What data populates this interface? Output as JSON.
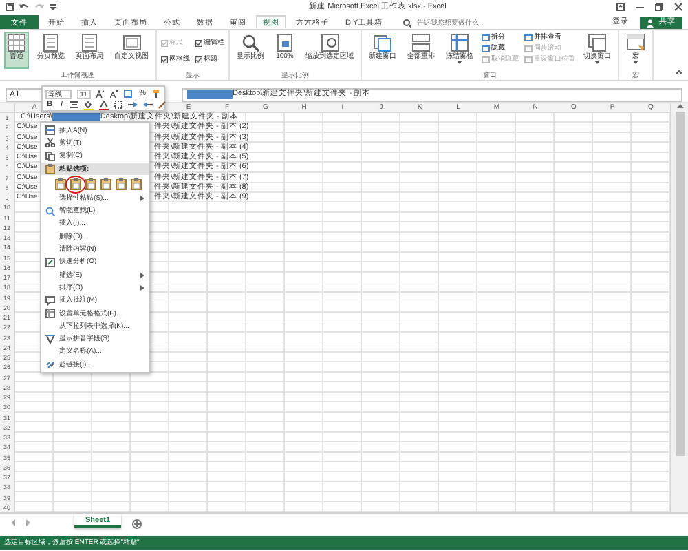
{
  "title_bar": {
    "title": "新建 Microsoft Excel 工作表.xlsx - Excel"
  },
  "tabs": [
    {
      "label": "文件",
      "kind": "file",
      "selected": false
    },
    {
      "label": "开始",
      "kind": "tab",
      "selected": false
    },
    {
      "label": "插入",
      "kind": "tab",
      "selected": false
    },
    {
      "label": "页面布局",
      "kind": "tab",
      "selected": false
    },
    {
      "label": "公式",
      "kind": "tab",
      "selected": false
    },
    {
      "label": "数据",
      "kind": "tab",
      "selected": false
    },
    {
      "label": "审阅",
      "kind": "tab",
      "selected": false
    },
    {
      "label": "视图",
      "kind": "tab",
      "selected": true
    },
    {
      "label": "方方格子",
      "kind": "tab",
      "selected": false
    },
    {
      "label": "DIY工具箱",
      "kind": "tab",
      "selected": false
    }
  ],
  "tell_me": {
    "placeholder": "告诉我您想要做什么..."
  },
  "account": {
    "sign_in": "登录",
    "share": "共享"
  },
  "ribbon": [
    {
      "title": "工作簿视图",
      "columns": [
        [
          {
            "kind": "large",
            "label": "普通",
            "selected": true
          }
        ],
        [
          {
            "kind": "large",
            "label": "分页预览",
            "selected": false
          }
        ],
        [
          {
            "kind": "large",
            "label": "页面布局",
            "selected": false
          }
        ],
        [
          {
            "kind": "large",
            "label": "自定义视图",
            "selected": false
          }
        ]
      ]
    },
    {
      "title": "显示",
      "columns": [
        [
          {
            "kind": "check",
            "label": "标尺",
            "checked": true,
            "disabled": true
          },
          {
            "kind": "check",
            "label": "网格线",
            "checked": true,
            "disabled": false
          }
        ],
        [
          {
            "kind": "check",
            "label": "编辑栏",
            "checked": true,
            "disabled": false
          },
          {
            "kind": "check",
            "label": "标题",
            "checked": true,
            "disabled": false
          }
        ]
      ]
    },
    {
      "title": "显示比例",
      "columns": [
        [
          {
            "kind": "large",
            "label": "显示比例"
          }
        ],
        [
          {
            "kind": "large",
            "label": "100%"
          }
        ],
        [
          {
            "kind": "large",
            "label": "缩放到选定区域"
          }
        ]
      ]
    },
    {
      "title": "窗口",
      "columns": [
        [
          {
            "kind": "large",
            "label": "新建窗口"
          }
        ],
        [
          {
            "kind": "large",
            "label": "全部重排"
          }
        ],
        [
          {
            "kind": "large",
            "label": "冻结窗格",
            "dropdown": true
          }
        ],
        [
          {
            "kind": "small",
            "label": "拆分",
            "disabled": false
          },
          {
            "kind": "small",
            "label": "隐藏",
            "disabled": false
          },
          {
            "kind": "small",
            "label": "取消隐藏",
            "disabled": true
          }
        ],
        [
          {
            "kind": "small",
            "label": "并排查看",
            "disabled": false
          },
          {
            "kind": "small",
            "label": "同步滚动",
            "disabled": true
          },
          {
            "kind": "small",
            "label": "重设窗口位置",
            "disabled": true
          }
        ],
        [
          {
            "kind": "large",
            "label": "切换窗口",
            "dropdown": true
          }
        ]
      ]
    },
    {
      "title": "宏",
      "columns": [
        [
          {
            "kind": "large",
            "label": "宏",
            "dropdown": true
          }
        ]
      ]
    }
  ],
  "formula_bar": {
    "name_box": "A1",
    "redacted": true,
    "value": "Desktop\\新建文件夹\\新建文件夹 - 副本"
  },
  "mini_toolbar": {
    "font": "等线",
    "size": "11",
    "percent": "%",
    "bold": "B",
    "italic": "I"
  },
  "columns": [
    "A",
    "E",
    "F",
    "G",
    "H",
    "I",
    "J",
    "K",
    "L",
    "M",
    "N",
    "O",
    "P",
    "Q"
  ],
  "rows": [
    {
      "number": "1",
      "left": "C:\\Users\\",
      "redacted": true,
      "right": "Desktop\\新建文件夹\\新建文件夹 - 副本"
    },
    {
      "number": "2",
      "left": "C:\\Use",
      "right": "件夹\\新建文件夹 - 副本 (2)"
    },
    {
      "number": "3",
      "left": "C:\\Use",
      "right": "件夹\\新建文件夹 - 副本 (3)"
    },
    {
      "number": "4",
      "left": "C:\\Use",
      "right": "件夹\\新建文件夹 - 副本 (4)"
    },
    {
      "number": "5",
      "left": "C:\\Use",
      "right": "件夹\\新建文件夹 - 副本 (5)"
    },
    {
      "number": "6",
      "left": "C:\\Use",
      "right": "件夹\\新建文件夹 - 副本 (6)"
    },
    {
      "number": "7",
      "left": "C:\\Use",
      "right": "件夹\\新建文件夹 - 副本 (7)"
    },
    {
      "number": "8",
      "left": "C:\\Use",
      "right": "件夹\\新建文件夹 - 副本 (8)"
    },
    {
      "number": "9",
      "left": "C:\\Use",
      "right": "件夹\\新建文件夹 - 副本 (9)"
    },
    {
      "number": "10"
    },
    {
      "number": "11"
    },
    {
      "number": "12"
    },
    {
      "number": "13"
    },
    {
      "number": "14"
    },
    {
      "number": "15"
    },
    {
      "number": "16"
    },
    {
      "number": "17"
    },
    {
      "number": "18"
    },
    {
      "number": "19"
    },
    {
      "number": "20"
    },
    {
      "number": "21"
    },
    {
      "number": "22"
    },
    {
      "number": "23"
    },
    {
      "number": "24"
    },
    {
      "number": "25"
    },
    {
      "number": "26"
    },
    {
      "number": "27"
    },
    {
      "number": "28"
    },
    {
      "number": "29"
    },
    {
      "number": "30"
    },
    {
      "number": "31"
    },
    {
      "number": "32"
    },
    {
      "number": "33"
    },
    {
      "number": "34"
    },
    {
      "number": "35"
    },
    {
      "number": "36"
    },
    {
      "number": "37"
    },
    {
      "number": "38"
    },
    {
      "number": "39"
    },
    {
      "number": "40"
    }
  ],
  "context_menu": [
    {
      "kind": "command",
      "label": "插入A(N)",
      "selected": false
    },
    {
      "kind": "command",
      "label": "剪切(T)",
      "selected": false
    },
    {
      "kind": "command",
      "label": "复制(C)",
      "selected": false
    },
    {
      "kind": "heading",
      "label": "粘贴选项:",
      "selected": true
    },
    {
      "kind": "paste-row",
      "options": [
        {
          "circled": false
        },
        {
          "circled": true
        },
        {
          "circled": false
        },
        {
          "circled": false
        },
        {
          "circled": false
        },
        {
          "circled": false
        }
      ]
    },
    {
      "kind": "submenu",
      "label": "选择性粘贴(S)...",
      "selected": false
    },
    {
      "kind": "command",
      "label": "智能查找(L)",
      "selected": false
    },
    {
      "kind": "command",
      "label": "插入(I)...",
      "selected": false
    },
    {
      "kind": "command",
      "label": "删除(D)...",
      "selected": false
    },
    {
      "kind": "command",
      "label": "清除内容(N)",
      "selected": false
    },
    {
      "kind": "command",
      "label": "快速分析(Q)",
      "selected": false
    },
    {
      "kind": "submenu",
      "label": "筛选(E)",
      "selected": false
    },
    {
      "kind": "submenu",
      "label": "排序(O)",
      "selected": false
    },
    {
      "kind": "command",
      "label": "插入批注(M)",
      "selected": false
    },
    {
      "kind": "command",
      "label": "设置单元格格式(F)...",
      "selected": false
    },
    {
      "kind": "command",
      "label": "从下拉列表中选择(K)...",
      "selected": false
    },
    {
      "kind": "command",
      "label": "显示拼音字段(S)",
      "selected": false
    },
    {
      "kind": "command",
      "label": "定义名称(A)...",
      "selected": false
    },
    {
      "kind": "command",
      "label": "超链接(I)...",
      "selected": false
    }
  ],
  "sheet_tabs": [
    {
      "label": "Sheet1",
      "selected": true
    }
  ],
  "status_bar": {
    "text": "选定目标区域，然后按 ENTER 或选择\"粘贴\""
  }
}
